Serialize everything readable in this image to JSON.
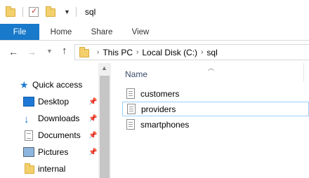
{
  "window": {
    "title": "sql"
  },
  "ribbon": {
    "tabs": [
      "File",
      "Home",
      "Share",
      "View"
    ]
  },
  "address": {
    "crumbs": [
      "This PC",
      "Local Disk (C:)",
      "sql"
    ]
  },
  "nav_pane": {
    "items": [
      {
        "label": "Quick access",
        "icon": "star-icon",
        "pinned": false
      },
      {
        "label": "Desktop",
        "icon": "desktop-icon",
        "pinned": true
      },
      {
        "label": "Downloads",
        "icon": "download-icon",
        "pinned": true
      },
      {
        "label": "Documents",
        "icon": "documents-icon",
        "pinned": true
      },
      {
        "label": "Pictures",
        "icon": "pictures-icon",
        "pinned": true
      },
      {
        "label": "internal",
        "icon": "folder-icon",
        "pinned": false
      }
    ]
  },
  "content": {
    "column_header": "Name",
    "files": [
      {
        "name": "customers",
        "selected": false
      },
      {
        "name": "providers",
        "selected": true
      },
      {
        "name": "smartphones",
        "selected": false
      }
    ]
  },
  "colors": {
    "accent": "#1979ca",
    "selection_border": "#99d1ff",
    "folder": "#f3d06c"
  }
}
